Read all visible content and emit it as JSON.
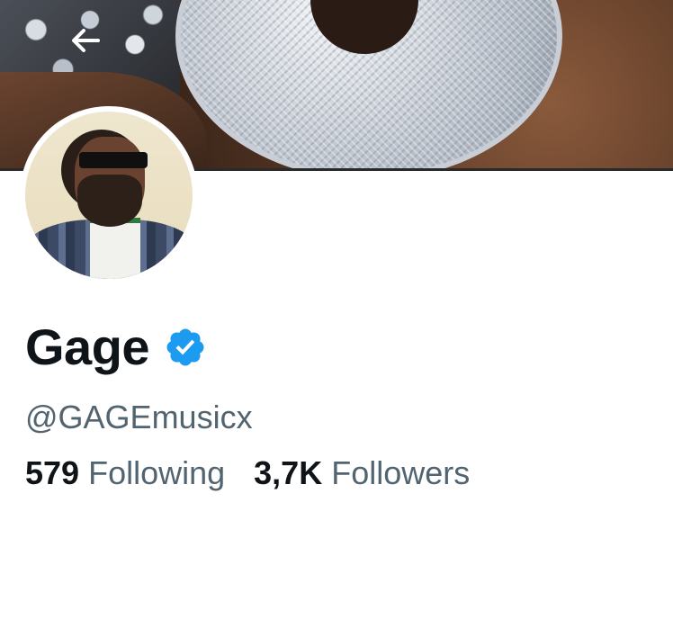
{
  "header": {
    "back_icon": "arrow-left-icon"
  },
  "profile": {
    "display_name": "Gage",
    "verified_icon": "verified-badge-icon",
    "verified_color": "#1d9bf0",
    "handle": "@GAGEmusicx"
  },
  "stats": {
    "following_count": "579",
    "following_label": "Following",
    "followers_count": "3,7K",
    "followers_label": "Followers"
  },
  "colors": {
    "primary_text": "#0f1419",
    "secondary_text": "#536471",
    "background": "#ffffff"
  }
}
